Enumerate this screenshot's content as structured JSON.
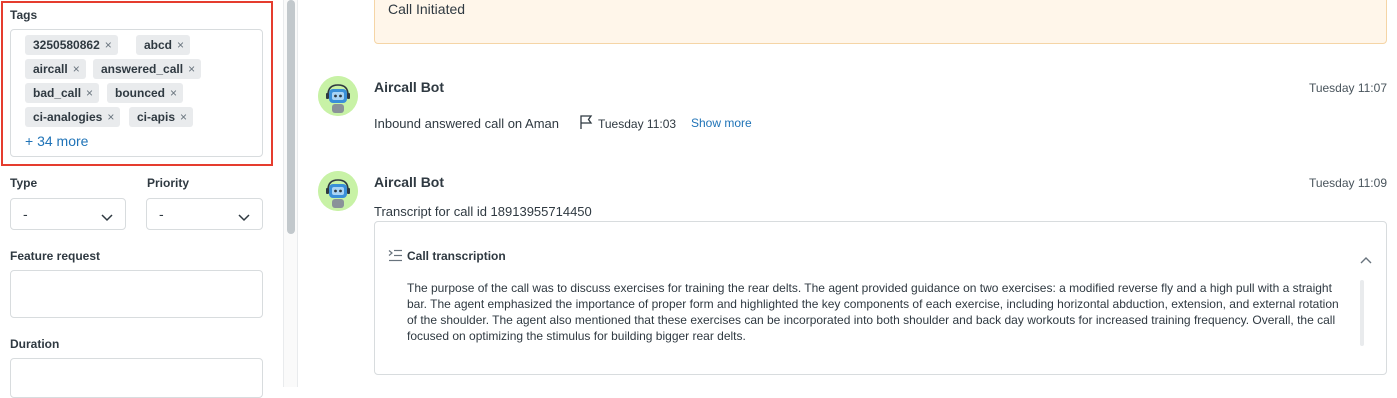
{
  "sidebar": {
    "tags_label": "Tags",
    "tags": [
      {
        "label": "3250580862"
      },
      {
        "label": "abcd"
      },
      {
        "label": "aircall"
      },
      {
        "label": "answered_call"
      },
      {
        "label": "bad_call"
      },
      {
        "label": "bounced"
      },
      {
        "label": "ci-analogies"
      },
      {
        "label": "ci-apis"
      }
    ],
    "tag_remove_glyph": "×",
    "more_tags": "+ 34 more",
    "type": {
      "label": "Type",
      "value": "-"
    },
    "priority": {
      "label": "Priority",
      "value": "-"
    },
    "feature_request": {
      "label": "Feature request",
      "value": ""
    },
    "duration": {
      "label": "Duration",
      "value": ""
    }
  },
  "timeline": {
    "initiated_text": "Call Initiated",
    "events": [
      {
        "author": "Aircall Bot",
        "time": "Tuesday 11:07",
        "text": "Inbound answered call on Aman",
        "flag_time": "Tuesday 11:03",
        "show_more": "Show more"
      },
      {
        "author": "Aircall Bot",
        "time": "Tuesday 11:09",
        "text": "Transcript for call id 18913955714450",
        "card_title": "Call transcription",
        "card_body": "The purpose of the call was to discuss exercises for training the rear delts. The agent provided guidance on two exercises: a modified reverse fly and a high pull with a straight bar. The agent emphasized the importance of proper form and highlighted the key components of each exercise, including horizontal abduction, extension, and external rotation of the shoulder. The agent also mentioned that these exercises can be incorporated into both shoulder and back day workouts for increased training frequency. Overall, the call focused on optimizing the stimulus for building bigger rear delts."
      }
    ]
  },
  "colors": {
    "highlight": "#e53c2e",
    "link": "#1f73b7",
    "tag_bg": "#e9ebed",
    "initiated_bg": "#fff6ea",
    "avatar_bg": "#c8f2a6"
  },
  "icons": {
    "tag_remove": "close-icon",
    "dropdown": "chevron-down-icon",
    "flag": "flag-icon",
    "transcript": "transcript-list-icon",
    "collapse": "chevron-up-icon",
    "bot_avatar": "robot-avatar"
  }
}
